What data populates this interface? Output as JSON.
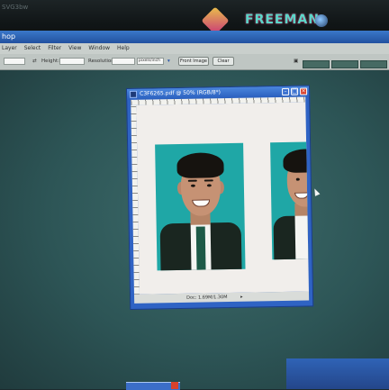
{
  "bezel": {
    "label": "SVG3bw",
    "brand": "FREEMAN"
  },
  "app": {
    "title": "hop"
  },
  "menu": {
    "items": [
      "Layer",
      "Select",
      "Filter",
      "View",
      "Window",
      "Help"
    ]
  },
  "options": {
    "height_label": "Height:",
    "resolution_label": "Resolution:",
    "units_value": "pixels/inch",
    "front_image_label": "Front Image",
    "clear_label": "Clear"
  },
  "document": {
    "title": "C3F6265.pdf @ 50% (RGB/8*)",
    "status_info": "Doc: 1.69M/1.30M",
    "scroll_arrow": "▸"
  },
  "colors": {
    "workspace": "#2d5556",
    "photo_background": "#1fa7a6",
    "titlebar": "#2f63c4"
  }
}
